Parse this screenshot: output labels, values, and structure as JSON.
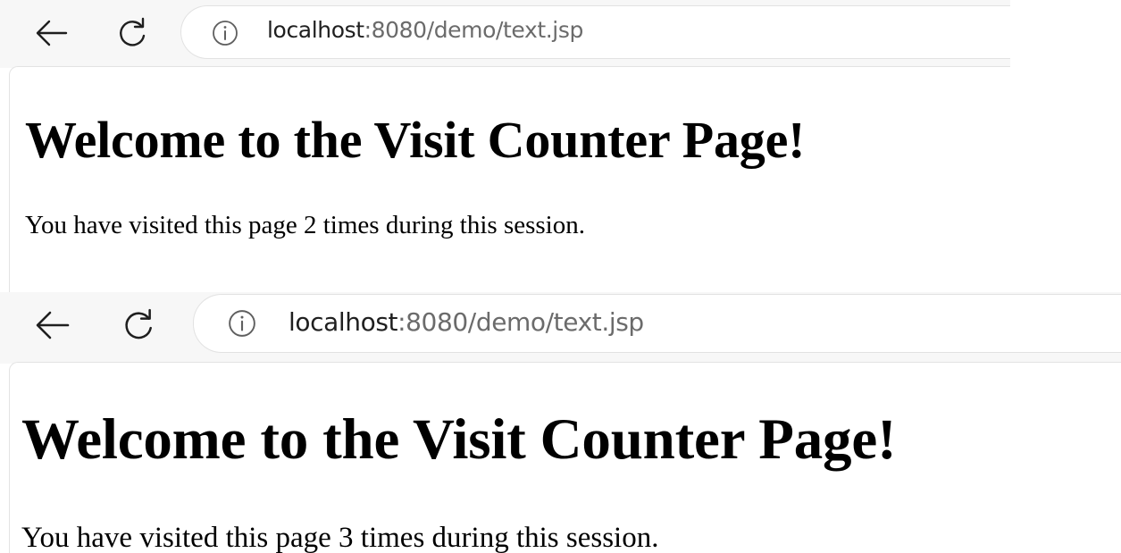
{
  "screens": [
    {
      "url_host": "localhost",
      "url_path": ":8080/demo/text.jsp",
      "heading": "Welcome to the Visit Counter Page!",
      "message": "You have visited this page 2 times during this session."
    },
    {
      "url_host": "localhost",
      "url_path": ":8080/demo/text.jsp",
      "heading": "Welcome to the Visit Counter Page!",
      "message": "You have visited this page 3 times during this session."
    }
  ],
  "icons": {
    "back": "back-arrow-icon",
    "reload": "reload-icon",
    "info": "info-icon"
  },
  "colors": {
    "toolbar": "#f7f7f7",
    "url_host": "#1f1f1f",
    "url_path": "#6b6b6b",
    "text": "#000000"
  }
}
